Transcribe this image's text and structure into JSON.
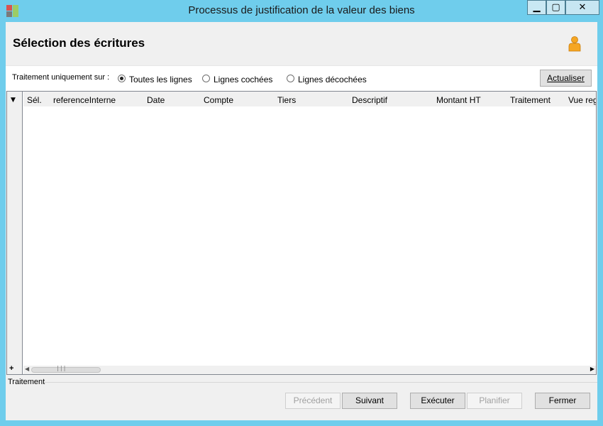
{
  "window": {
    "title": "Processus de justification de la valeur des biens",
    "controls": {
      "minimize": "▁",
      "maximize": "▢",
      "close": "✕"
    }
  },
  "header": {
    "title": "Sélection des écritures",
    "user_icon": "user-icon"
  },
  "options": {
    "label": "Traitement uniquement sur :",
    "radios": [
      {
        "label": "Toutes les lignes",
        "checked": true
      },
      {
        "label": "Lignes cochées",
        "checked": false
      },
      {
        "label": "Lignes décochées",
        "checked": false
      }
    ],
    "refresh_label": "Actualiser"
  },
  "grid": {
    "columns": [
      "Sél.",
      "referenceInterne",
      "Date",
      "Compte",
      "Tiers",
      "Descriptif",
      "Montant HT",
      "Traitement",
      "Vue reg"
    ],
    "rows": [],
    "add_label": "+"
  },
  "section": {
    "label": "Traitement"
  },
  "footer": {
    "prev_label": "Précédent",
    "next_label": "Suivant",
    "execute_label": "Exécuter",
    "plan_label": "Planifier",
    "close_label": "Fermer"
  },
  "colors": {
    "titlebar": "#6fcdec",
    "accent_user_icon": "#f5a623"
  }
}
